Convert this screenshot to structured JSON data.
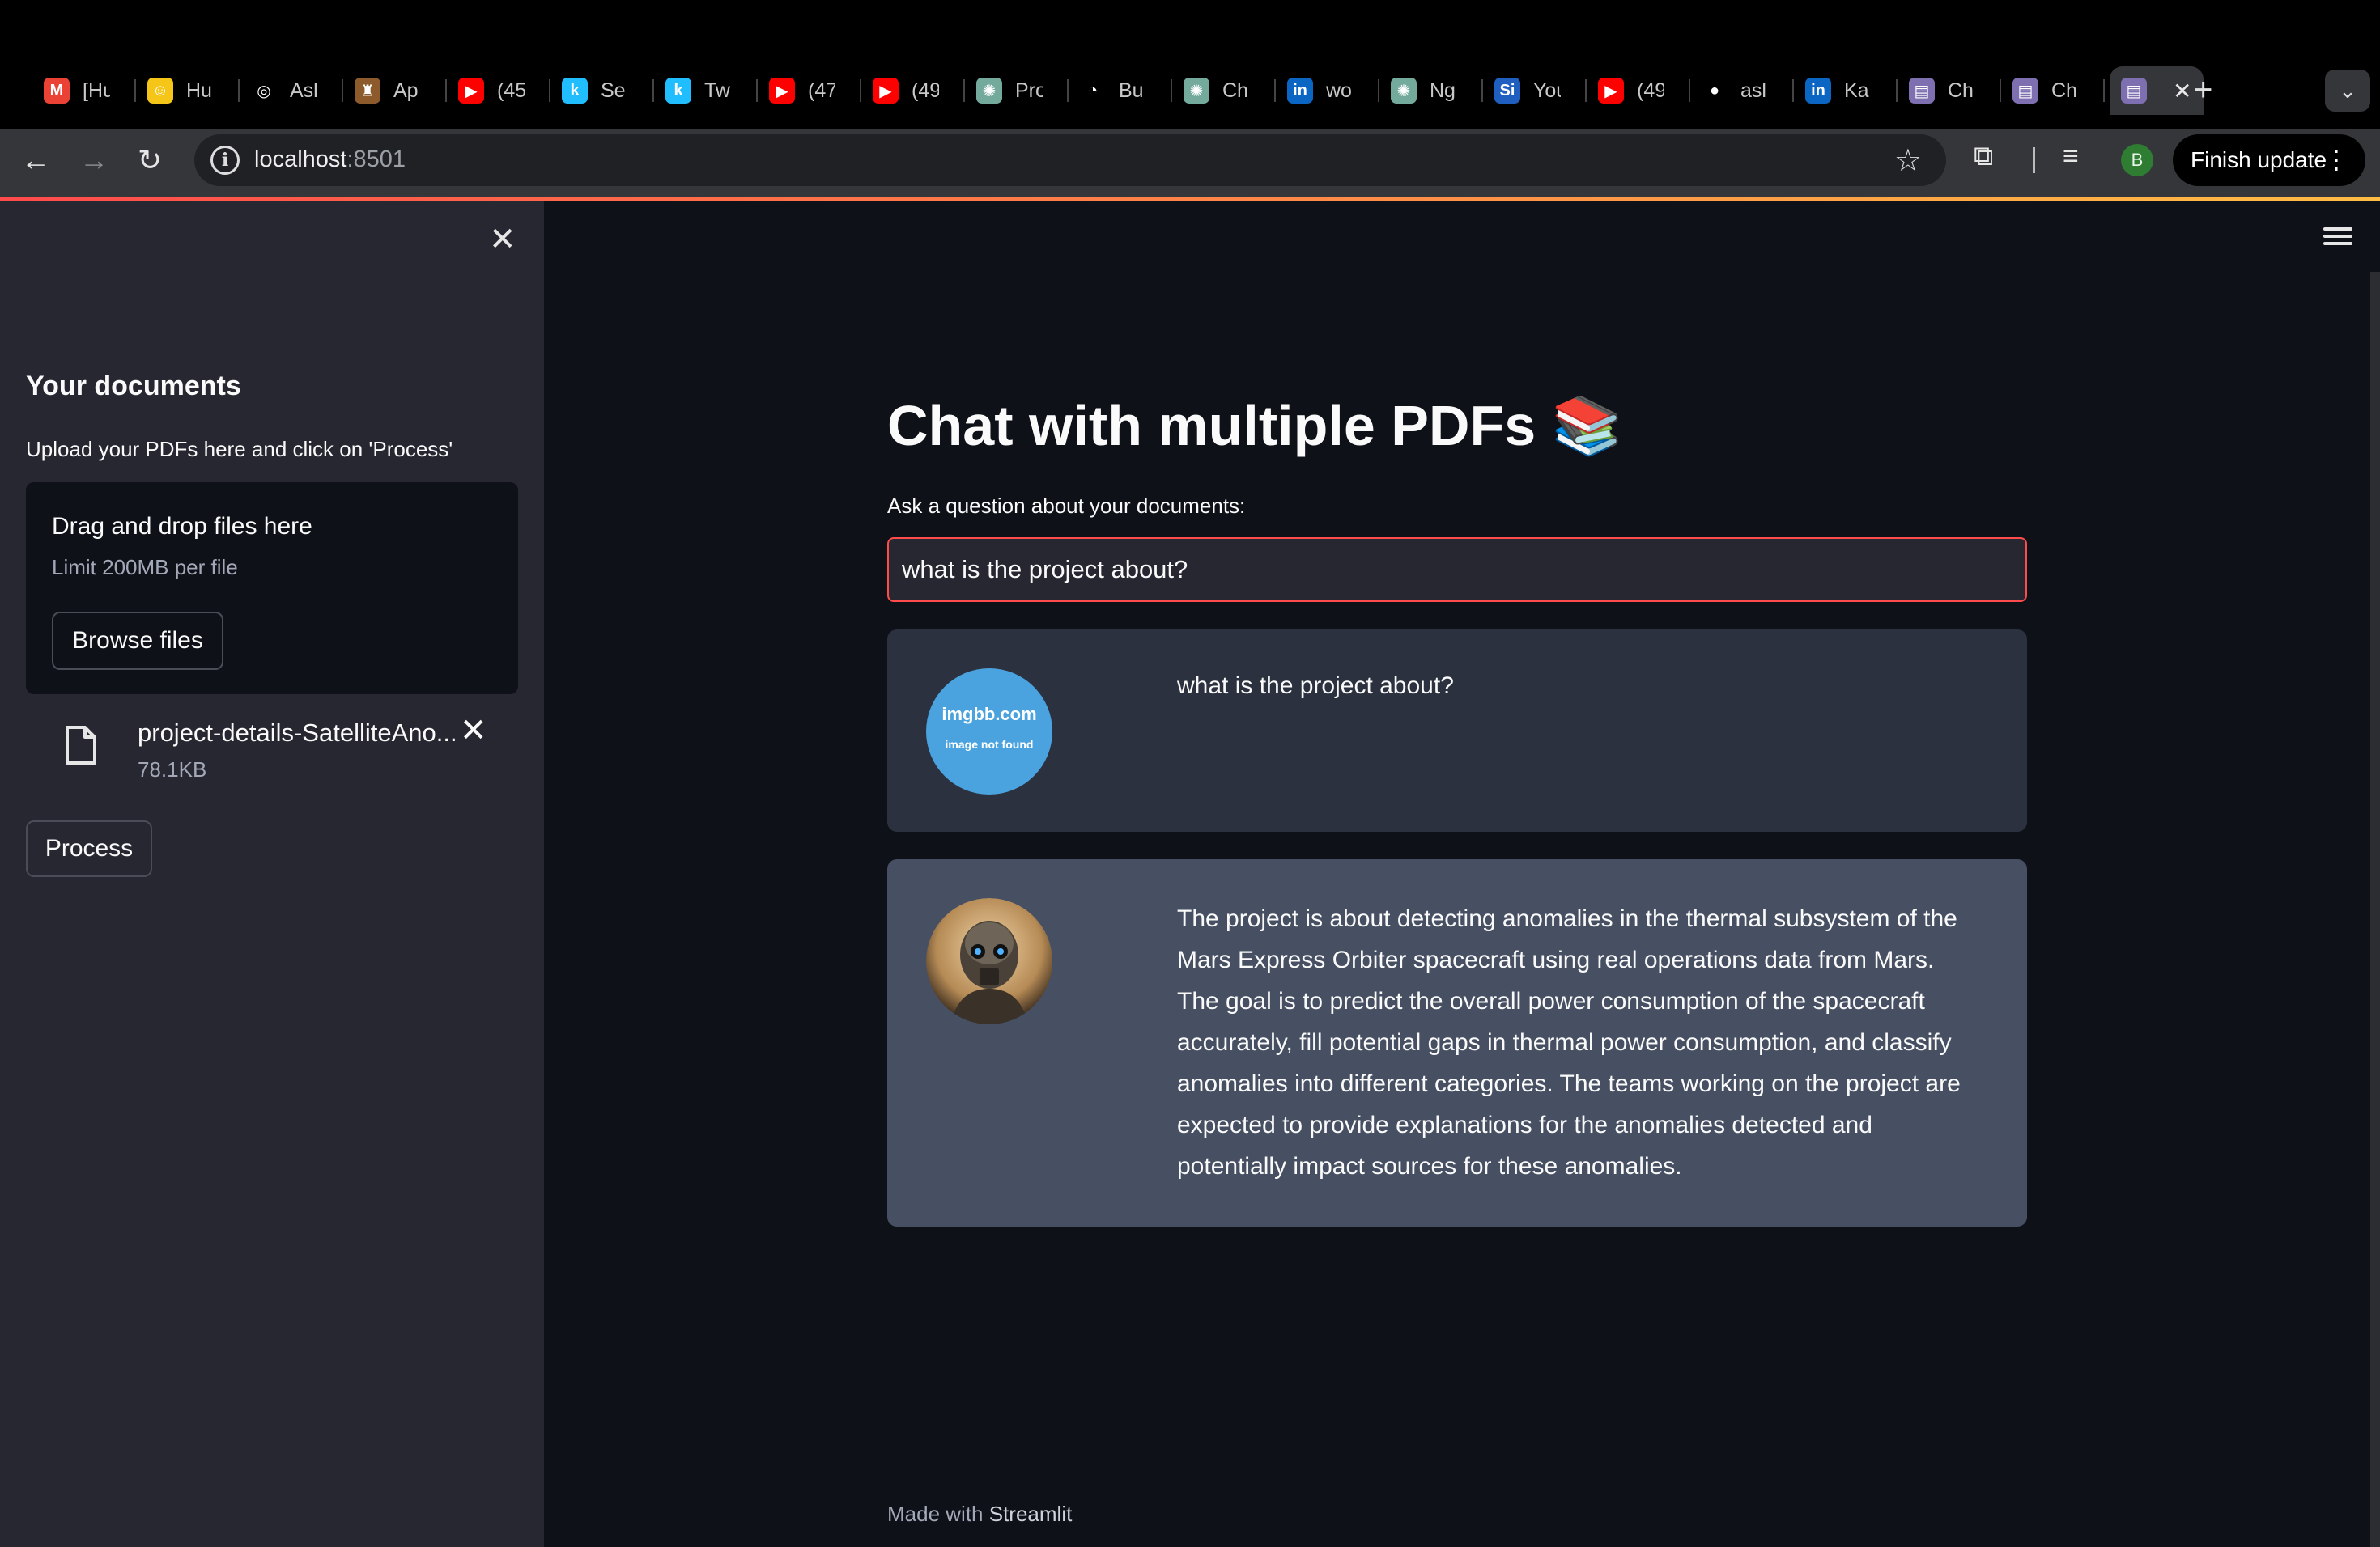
{
  "browser": {
    "tabs": [
      {
        "title": "[Hu",
        "icon": "gmail-icon",
        "color": "#ea4335",
        "glyph": "M"
      },
      {
        "title": "Hu",
        "icon": "hugging-face-icon",
        "color": "#f5c518",
        "glyph": "☺"
      },
      {
        "title": "Asl",
        "icon": "openai-icon",
        "color": "#000000",
        "glyph": "◎"
      },
      {
        "title": "Ap",
        "icon": "porsche-icon",
        "color": "#8d5a2b",
        "glyph": "♜"
      },
      {
        "title": "(45",
        "icon": "youtube-icon",
        "color": "#ff0000",
        "glyph": "▶"
      },
      {
        "title": "Se",
        "icon": "kaggle-icon",
        "color": "#20beff",
        "glyph": "k"
      },
      {
        "title": "Tw",
        "icon": "kaggle-icon",
        "color": "#20beff",
        "glyph": "k"
      },
      {
        "title": "(47",
        "icon": "youtube-icon",
        "color": "#ff0000",
        "glyph": "▶"
      },
      {
        "title": "(49",
        "icon": "youtube-icon",
        "color": "#ff0000",
        "glyph": "▶"
      },
      {
        "title": "Pro",
        "icon": "chatgpt-icon",
        "color": "#74aa9c",
        "glyph": "✺"
      },
      {
        "title": "Bu",
        "icon": "compass-icon",
        "color": "#000000",
        "glyph": "◔"
      },
      {
        "title": "Ch",
        "icon": "chatgpt-icon",
        "color": "#74aa9c",
        "glyph": "✺"
      },
      {
        "title": "wo",
        "icon": "linkedin-icon",
        "color": "#0a66c2",
        "glyph": "in"
      },
      {
        "title": "Ng",
        "icon": "chatgpt-icon",
        "color": "#74aa9c",
        "glyph": "✺"
      },
      {
        "title": "You",
        "icon": "si-icon",
        "color": "#1f5fbf",
        "glyph": "Si"
      },
      {
        "title": "(49",
        "icon": "youtube-icon",
        "color": "#ff0000",
        "glyph": "▶"
      },
      {
        "title": "asl",
        "icon": "github-icon",
        "color": "#000000",
        "glyph": "●"
      },
      {
        "title": "Ka",
        "icon": "linkedin-icon",
        "color": "#0a66c2",
        "glyph": "in"
      },
      {
        "title": "Ch",
        "icon": "books-icon",
        "color": "#7d6fb0",
        "glyph": "▤"
      },
      {
        "title": "Ch",
        "icon": "books-icon",
        "color": "#7d6fb0",
        "glyph": "▤"
      }
    ],
    "active_tab": {
      "icon": "books-icon",
      "close": "✕"
    },
    "new_tab": "+",
    "url_host": "localhost",
    "url_port": ":8501",
    "profile_initial": "B",
    "finish_update": "Finish update"
  },
  "sidebar": {
    "title": "Your documents",
    "upload_label": "Upload your PDFs here and click on 'Process'",
    "dropzone_title": "Drag and drop files here",
    "dropzone_limit": "Limit 200MB per file",
    "browse_button": "Browse files",
    "file": {
      "name": "project-details-SatelliteAno...",
      "size": "78.1KB"
    },
    "process_button": "Process"
  },
  "main": {
    "title": "Chat with multiple PDFs 📚",
    "question_label": "Ask a question about your documents:",
    "question_value": "what is the project about?",
    "messages": [
      {
        "role": "user",
        "avatar_line1": "imgbb.com",
        "avatar_line2": "image not found",
        "text": "what is the project about?"
      },
      {
        "role": "bot",
        "text": "The project is about detecting anomalies in the thermal subsystem of the Mars Express Orbiter spacecraft using real operations data from Mars. The goal is to predict the overall power consumption of the spacecraft accurately, fill potential gaps in thermal power consumption, and classify anomalies into different categories. The teams working on the project are expected to provide explanations for the anomalies detected and potentially impact sources for these anomalies."
      }
    ],
    "footer_prefix": "Made with ",
    "footer_brand": "Streamlit"
  },
  "colors": {
    "accent": "#ff4b4b",
    "sidebar_bg": "#262730",
    "main_bg": "#0e1117",
    "user_msg_bg": "#2b313e",
    "bot_msg_bg": "#475063"
  }
}
